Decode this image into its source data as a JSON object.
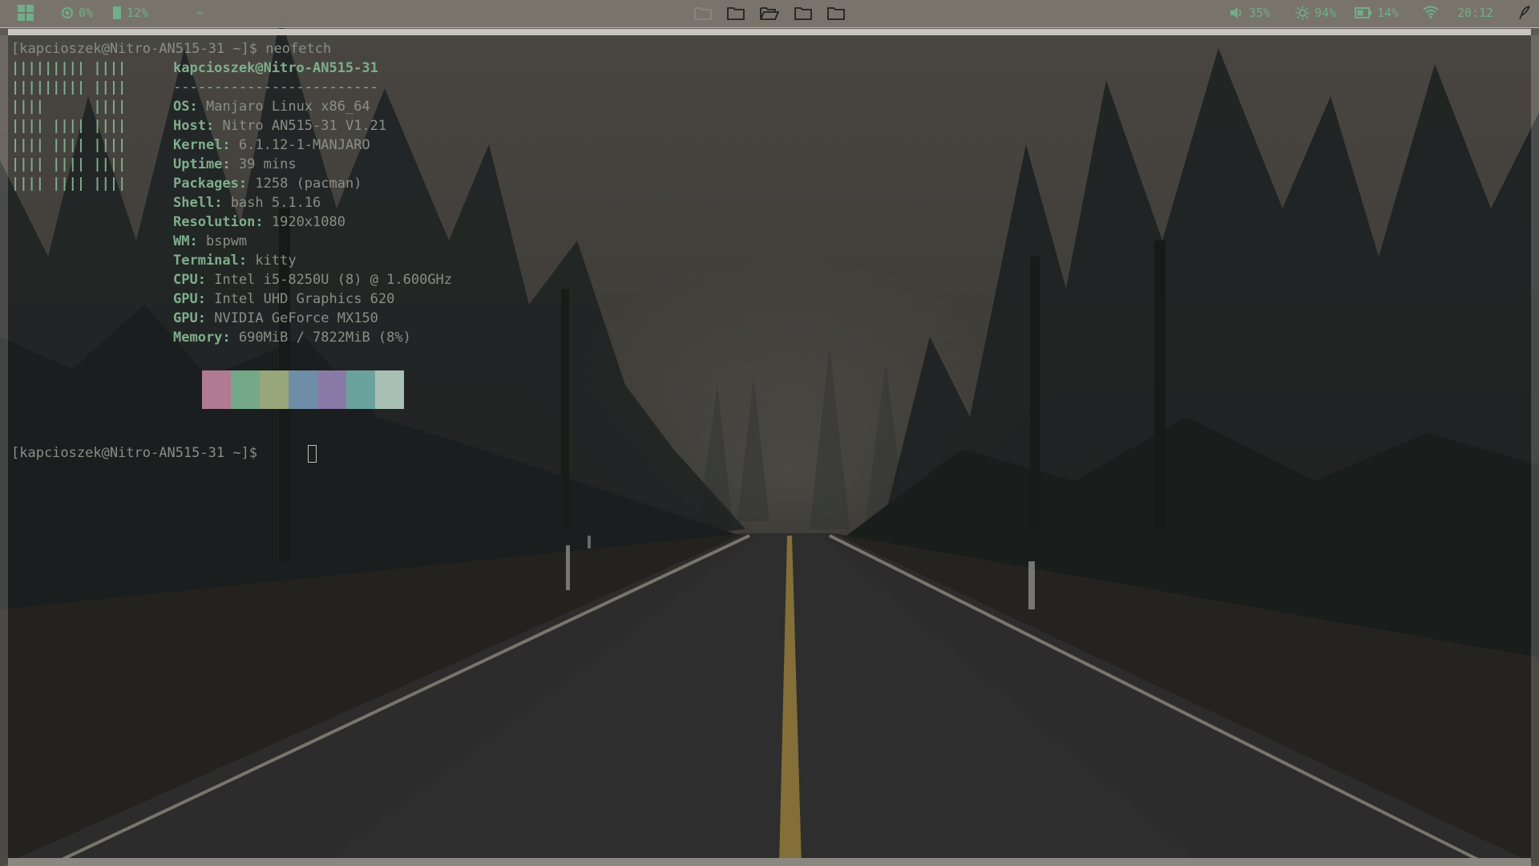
{
  "topbar": {
    "cpu": "0%",
    "ram": "12%",
    "home": "~",
    "workspaces": [
      "folder-icon",
      "folder-icon",
      "folder-open-icon",
      "folder-icon",
      "folder-icon"
    ],
    "volume": "35%",
    "brightness": "94%",
    "battery": "14%",
    "clock": "20:12",
    "accent": "#6fae8a"
  },
  "terminal": {
    "prompt": "[kapcioszek@Nitro-AN515-31 ~]$",
    "command": "neofetch",
    "logo_lines": [
      "||||||||| ||||",
      "||||||||| ||||",
      "||||      ||||",
      "|||| |||| ||||",
      "|||| |||| ||||",
      "|||| |||| ||||",
      "|||| |||| ||||"
    ],
    "title": "kapcioszek@Nitro-AN515-31",
    "separator": "-------------------------",
    "info": [
      {
        "key": "OS",
        "value": "Manjaro Linux x86_64"
      },
      {
        "key": "Host",
        "value": "Nitro AN515-31 V1.21"
      },
      {
        "key": "Kernel",
        "value": "6.1.12-1-MANJARO"
      },
      {
        "key": "Uptime",
        "value": "39 mins"
      },
      {
        "key": "Packages",
        "value": "1258 (pacman)"
      },
      {
        "key": "Shell",
        "value": "bash 5.1.16"
      },
      {
        "key": "Resolution",
        "value": "1920x1080"
      },
      {
        "key": "WM",
        "value": "bspwm"
      },
      {
        "key": "Terminal",
        "value": "kitty"
      },
      {
        "key": "CPU",
        "value": "Intel i5-8250U (8) @ 1.600GHz"
      },
      {
        "key": "GPU",
        "value": "Intel UHD Graphics 620"
      },
      {
        "key": "GPU",
        "value": "NVIDIA GeForce MX150"
      },
      {
        "key": "Memory",
        "value": "690MiB / 7822MiB (8%)"
      }
    ],
    "palette": [
      "#b07a92",
      "#74a888",
      "#98a67c",
      "#6e8ea8",
      "#8a7aa8",
      "#6aa39e",
      "#a9c0b4"
    ],
    "prompt2": "[kapcioszek@Nitro-AN515-31 ~]$"
  }
}
